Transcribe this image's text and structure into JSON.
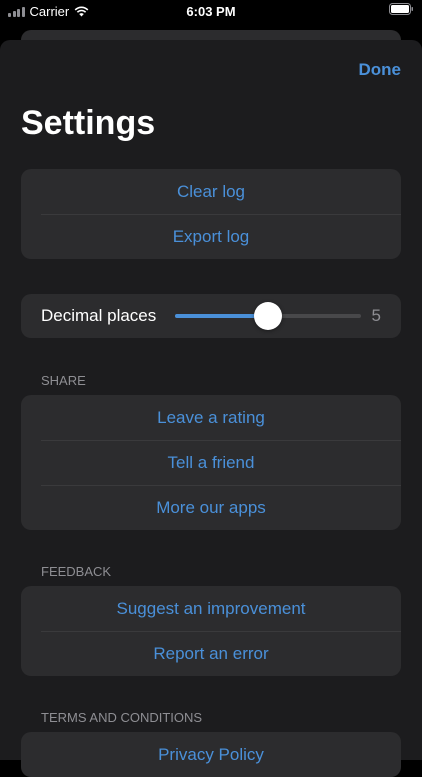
{
  "status_bar": {
    "carrier": "Carrier",
    "time": "6:03 PM",
    "wifi_icon": "wifi-icon",
    "battery_icon": "battery-icon"
  },
  "nav": {
    "done_label": "Done",
    "title": "Settings"
  },
  "log_group": {
    "items": [
      {
        "label": "Clear log"
      },
      {
        "label": "Export log"
      }
    ]
  },
  "decimal": {
    "label": "Decimal places",
    "value": "5",
    "fraction": 0.5
  },
  "share": {
    "header": "SHARE",
    "items": [
      {
        "label": "Leave a rating"
      },
      {
        "label": "Tell a friend"
      },
      {
        "label": "More our apps"
      }
    ]
  },
  "feedback": {
    "header": "FEEDBACK",
    "items": [
      {
        "label": "Suggest an improvement"
      },
      {
        "label": "Report an error"
      }
    ]
  },
  "terms": {
    "header": "TERMS AND CONDITIONS",
    "items": [
      {
        "label": "Privacy Policy"
      }
    ]
  },
  "colors": {
    "accent": "#4a90d9",
    "background": "#1c1c1e",
    "cell": "#2c2c2e",
    "secondary_text": "#8e8e93"
  }
}
